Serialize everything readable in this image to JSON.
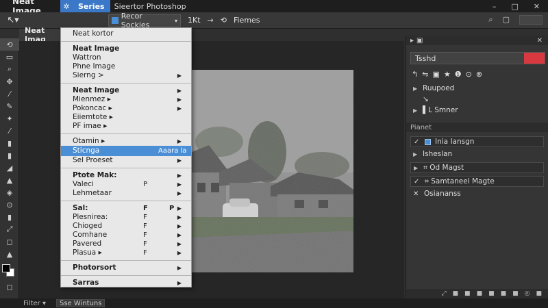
{
  "menubar": {
    "app_title": "Neat Image",
    "ps_badge": "✲",
    "active_menu": "Series",
    "window_title": "Sieertor Photoshop",
    "win_controls": [
      "–",
      "□",
      "✕"
    ]
  },
  "options": {
    "tool_glyph": "↖▾",
    "recent_label": "Recor Sockies",
    "opt_items": [
      "1Kt",
      "→",
      "⟲",
      "Fiemes"
    ],
    "right_icons": [
      "⌕",
      "▢"
    ]
  },
  "doc_tab": {
    "label": "Neat Imag"
  },
  "tools": [
    "⟲",
    "▭",
    "⌕",
    "✥",
    "⁄",
    "✎",
    "✦",
    "⁄",
    "▮",
    "▮",
    "◢",
    "▲",
    "◈",
    "⊙",
    "▮",
    "⤢",
    "◻",
    "▲",
    "◻"
  ],
  "menu": {
    "items": [
      {
        "label": "Neat kortor",
        "bold": false,
        "arrow": false,
        "sc": ""
      },
      {
        "sep": true
      },
      {
        "label": "Neat Image",
        "bold": true,
        "arrow": false,
        "sc": ""
      },
      {
        "label": "Wattron",
        "bold": false,
        "arrow": false,
        "sc": ""
      },
      {
        "label": "Phne Image",
        "bold": false,
        "arrow": false,
        "sc": ""
      },
      {
        "label": "Sierng >",
        "bold": false,
        "arrow": true,
        "sc": ""
      },
      {
        "sep": true
      },
      {
        "label": "Neat Image",
        "bold": true,
        "arrow": true,
        "sc": ""
      },
      {
        "label": "Mienmez ▸",
        "bold": false,
        "arrow": true,
        "sc": ""
      },
      {
        "label": "Pokoncac ▸",
        "bold": false,
        "arrow": true,
        "sc": ""
      },
      {
        "label": "Eiiemtote ▸",
        "bold": false,
        "arrow": false,
        "sc": ""
      },
      {
        "label": "PF imae ▸",
        "bold": false,
        "arrow": false,
        "sc": ""
      },
      {
        "sep": true
      },
      {
        "label": "Otamin ▸",
        "bold": false,
        "arrow": true,
        "sc": ""
      },
      {
        "label": "Sticnga",
        "bold": false,
        "arrow": false,
        "sc": "Aaara la",
        "highlight": true
      },
      {
        "label": "Sel Proeset",
        "bold": false,
        "arrow": true,
        "sc": ""
      },
      {
        "sep": true
      },
      {
        "label": "Ptote Mak:",
        "bold": true,
        "arrow": true,
        "sc": ""
      },
      {
        "label": "Valeci",
        "bold": false,
        "arrow": true,
        "sc": "P"
      },
      {
        "label": "Lehmetaar",
        "bold": false,
        "arrow": true,
        "sc": ""
      },
      {
        "sep": true
      },
      {
        "label": "Sal:",
        "bold": true,
        "arrow": true,
        "sc": "F",
        "sc2": "P"
      },
      {
        "label": "Plesnirea:",
        "bold": false,
        "arrow": true,
        "sc": "F"
      },
      {
        "label": "Chioged",
        "bold": false,
        "arrow": true,
        "sc": "F"
      },
      {
        "label": "Comhane",
        "bold": false,
        "arrow": true,
        "sc": "F"
      },
      {
        "label": "Pavered",
        "bold": false,
        "arrow": true,
        "sc": "F"
      },
      {
        "label": "Plasua ▸",
        "bold": false,
        "arrow": true,
        "sc": "F"
      },
      {
        "sep": true
      },
      {
        "label": "Photorsort",
        "bold": true,
        "arrow": true,
        "sc": ""
      },
      {
        "sep": true
      },
      {
        "label": "Sarras",
        "bold": true,
        "arrow": true,
        "sc": ""
      }
    ]
  },
  "status": {
    "filter": "Filter",
    "filter_arrow": "▾",
    "select_label": "Sse Wintuns"
  },
  "panel": {
    "head_icons": [
      "▸",
      "▣"
    ],
    "close": "✕",
    "field_label": "Tsshd",
    "icon_row": [
      "↰",
      "⇋",
      "▣",
      "★",
      "❶",
      "⊙",
      "⊗"
    ],
    "rows_top": [
      {
        "tri": "▶",
        "label": "Ruupoed",
        "check": false,
        "box": false
      },
      {
        "tri": "",
        "label": "↘",
        "check": false,
        "box": false
      },
      {
        "tri": "▶",
        "label": "▌L Smner",
        "check": false,
        "box": true
      }
    ],
    "section_label": "Pianet",
    "rows_bottom": [
      {
        "tri": "✓",
        "label": "Inia Iansgn",
        "box": true,
        "blue": true
      },
      {
        "tri": "▶",
        "label": "Isheslan",
        "box": false,
        "blue": false
      },
      {
        "tri": "▶",
        "label": "⌗ Od Magst",
        "box": true,
        "blue": false
      },
      {
        "tri": "✓",
        "label": "⌗ Samtaneel Magte",
        "box": true,
        "blue": false
      },
      {
        "tri": "✕",
        "label": "Osiananss",
        "box": false,
        "blue": false
      }
    ],
    "footer_icons": [
      "⤢",
      "■",
      "■",
      "■",
      "■",
      "■",
      "■",
      "◎",
      "■"
    ]
  }
}
